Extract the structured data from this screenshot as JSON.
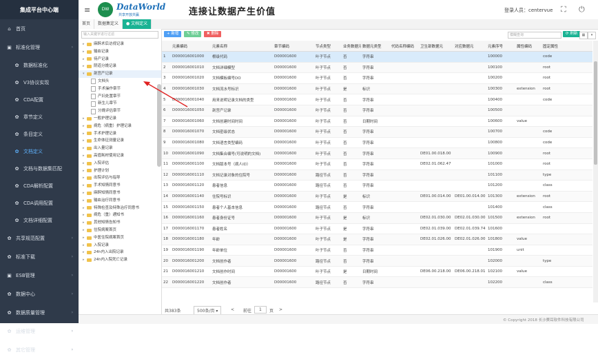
{
  "app": {
    "title": "集成平台中心端"
  },
  "sidebar": {
    "items": [
      {
        "label": "首页",
        "icon": "home-icon",
        "glyph": "⌂",
        "sub": false
      },
      {
        "label": "标准化管理",
        "icon": "folder-icon",
        "glyph": "▣",
        "sub": false
      },
      {
        "label": "数据标准化",
        "icon": "gear-icon",
        "glyph": "✿",
        "sub": true
      },
      {
        "label": "V3协议实现",
        "icon": "gear-icon",
        "glyph": "✿",
        "sub": true
      },
      {
        "label": "CDA配置",
        "icon": "gear-icon",
        "glyph": "✿",
        "sub": true
      },
      {
        "label": "章节定义",
        "icon": "gear-icon",
        "glyph": "✿",
        "sub": true
      },
      {
        "label": "条目定义",
        "icon": "gear-icon",
        "glyph": "✿",
        "sub": true
      },
      {
        "label": "文档定义",
        "icon": "gear-icon",
        "glyph": "✿",
        "sub": true,
        "active": true
      },
      {
        "label": "文档与数据集匹配",
        "icon": "gear-icon",
        "glyph": "✿",
        "sub": true
      },
      {
        "label": "CDA解析配置",
        "icon": "gear-icon",
        "glyph": "✿",
        "sub": true
      },
      {
        "label": "CDA调用配置",
        "icon": "gear-icon",
        "glyph": "✿",
        "sub": true
      },
      {
        "label": "文档详细配置",
        "icon": "gear-icon",
        "glyph": "✿",
        "sub": true
      },
      {
        "label": "共享规范配置",
        "icon": "gear-icon",
        "glyph": "✿",
        "sub": false
      },
      {
        "label": "标准下载",
        "icon": "gear-icon",
        "glyph": "✿",
        "sub": false
      },
      {
        "label": "ESB管理",
        "icon": "folder-icon",
        "glyph": "▣",
        "sub": false
      },
      {
        "label": "数据中心",
        "icon": "gear-icon",
        "glyph": "✿",
        "sub": false
      },
      {
        "label": "数据质量管理",
        "icon": "gear-icon",
        "glyph": "✿",
        "sub": false
      },
      {
        "label": "运维管理",
        "icon": "gear-icon",
        "glyph": "✿",
        "sub": false
      },
      {
        "label": "其它管理",
        "icon": "gear-icon",
        "glyph": "✿",
        "sub": false
      }
    ]
  },
  "header": {
    "brand": "DataWorld",
    "brand_sub": "共享开放共赢",
    "slogan": "连接让数据产生价值",
    "user": "登录人员：centervue"
  },
  "tabs": [
    {
      "label": "首页",
      "active": false
    },
    {
      "label": "数据集定义",
      "active": false
    },
    {
      "label": "● 文档定义",
      "active": true
    }
  ],
  "tree": {
    "search_placeholder": "输入关键字进行过滤",
    "nodes": [
      {
        "label": "麻醉术后访视记录",
        "level": 0,
        "kind": "folder"
      },
      {
        "label": "输血记录",
        "level": 0,
        "kind": "folder"
      },
      {
        "label": "待产记录",
        "level": 0,
        "kind": "folder"
      },
      {
        "label": "阴道分娩记录",
        "level": 0,
        "kind": "folder"
      },
      {
        "label": "剖宫产记录",
        "level": 0,
        "kind": "folder",
        "open": true
      },
      {
        "label": "文档头",
        "level": 1,
        "kind": "file"
      },
      {
        "label": "手术操作章节",
        "level": 1,
        "kind": "file"
      },
      {
        "label": "产妇处置章节",
        "level": 1,
        "kind": "file"
      },
      {
        "label": "新生儿章节",
        "level": 1,
        "kind": "file"
      },
      {
        "label": "分娩评估章节",
        "level": 1,
        "kind": "file"
      },
      {
        "label": "一般护理记录",
        "level": 0,
        "kind": "folder"
      },
      {
        "label": "病危（病重）护理记录",
        "level": 0,
        "kind": "folder"
      },
      {
        "label": "手术护理记录",
        "level": 0,
        "kind": "folder"
      },
      {
        "label": "生命体征测量记录",
        "level": 0,
        "kind": "folder"
      },
      {
        "label": "出入量记录",
        "level": 0,
        "kind": "folder"
      },
      {
        "label": "高值耗材使用记录",
        "level": 0,
        "kind": "folder"
      },
      {
        "label": "入院评估",
        "level": 0,
        "kind": "folder"
      },
      {
        "label": "护理计划",
        "level": 0,
        "kind": "folder"
      },
      {
        "label": "出院评估与指导",
        "level": 0,
        "kind": "folder"
      },
      {
        "label": "手术知情同意书",
        "level": 0,
        "kind": "folder"
      },
      {
        "label": "麻醉知情同意书",
        "level": 0,
        "kind": "folder"
      },
      {
        "label": "输血治疗同意书",
        "level": 0,
        "kind": "folder"
      },
      {
        "label": "特殊检查及特殊治疗同意书",
        "level": 0,
        "kind": "folder"
      },
      {
        "label": "病危（重）通知书",
        "level": 0,
        "kind": "folder"
      },
      {
        "label": "其他知情告知书",
        "level": 0,
        "kind": "folder"
      },
      {
        "label": "住院病案首页",
        "level": 0,
        "kind": "folder"
      },
      {
        "label": "中医住院病案首页",
        "level": 0,
        "kind": "folder"
      },
      {
        "label": "入院记录",
        "level": 0,
        "kind": "folder"
      },
      {
        "label": "24h内入出院记录",
        "level": 0,
        "kind": "folder"
      },
      {
        "label": "24h内入院死亡记录",
        "level": 0,
        "kind": "folder"
      }
    ]
  },
  "toolbar": {
    "add": "+ 新增",
    "edit": "✎ 修改",
    "delete": "✖ 删除",
    "search_placeholder": "模糊查询",
    "refresh": "⟳ 刷新",
    "table_icon": "▦",
    "dropdown_icon": "▾"
  },
  "table": {
    "columns": [
      "",
      "元素编码",
      "元素名称",
      "章节编码",
      "节点类型",
      "业务数据元",
      "数据元类型",
      "代码名称编码",
      "卫生部数据元",
      "对应数据元",
      "元素序号",
      "属性编码",
      "固定属性"
    ],
    "rows": [
      [
        "1",
        "D000016001000",
        "根级代码",
        "D00001600",
        "叶子节点",
        "否",
        "字符串",
        "",
        "",
        "",
        "100000",
        "",
        "code"
      ],
      [
        "2",
        "D000016001010",
        "文档详细模型",
        "D00001600",
        "叶子节点",
        "否",
        "字符串",
        "",
        "",
        "",
        "100100",
        "",
        "root"
      ],
      [
        "3",
        "D000016001020",
        "文档模板编号DO",
        "D00001600",
        "叶子节点",
        "否",
        "字符串",
        "",
        "",
        "",
        "100200",
        "",
        "root"
      ],
      [
        "4",
        "D000016001030",
        "文档流水号标识",
        "D00001600",
        "叶子节点",
        "是",
        "标识",
        "",
        "",
        "",
        "100300",
        "extension",
        "root"
      ],
      [
        "5",
        "D000016001040",
        "用来说明记录文档的类型",
        "D00001600",
        "叶子节点",
        "否",
        "字符串",
        "",
        "",
        "",
        "100400",
        "",
        "code"
      ],
      [
        "6",
        "D000016001050",
        "剖宫产记录",
        "D00001600",
        "叶子节点",
        "否",
        "字符串",
        "",
        "",
        "",
        "100500",
        "",
        ""
      ],
      [
        "7",
        "D000016001060",
        "文档创建时间时间",
        "D00001600",
        "叶子节点",
        "否",
        "日期时间",
        "",
        "",
        "",
        "100600",
        "value",
        ""
      ],
      [
        "8",
        "D000016001070",
        "文档密级状态",
        "D00001600",
        "叶子节点",
        "否",
        "字符串",
        "",
        "",
        "",
        "100700",
        "",
        "code"
      ],
      [
        "9",
        "D000016001080",
        "文档语言类型编码",
        "D00001600",
        "叶子节点",
        "否",
        "字符串",
        "",
        "",
        "",
        "100800",
        "",
        "code"
      ],
      [
        "10",
        "D000016001090",
        "文档集合编号(可说明的文档)",
        "D00001600",
        "叶子节点",
        "否",
        "字符串",
        "",
        "DE01.00.018.00",
        "",
        "100900",
        "",
        "root"
      ],
      [
        "11",
        "D000016001100",
        "文档版本号（病人ID）",
        "D00001600",
        "叶子节点",
        "否",
        "字符串",
        "",
        "DE02.01.062.47",
        "",
        "101000",
        "",
        "root"
      ],
      [
        "12",
        "D000016001110",
        "文档记录对象的住院号",
        "D00001600",
        "路径节点",
        "否",
        "字符串",
        "",
        "",
        "",
        "101100",
        "",
        "type"
      ],
      [
        "13",
        "D000016001120",
        "患者信息",
        "D00001600",
        "路径节点",
        "否",
        "字符串",
        "",
        "",
        "",
        "101200",
        "",
        "class"
      ],
      [
        "14",
        "D000016001140",
        "住院号标识",
        "D00001600",
        "叶子节点",
        "是",
        "标识",
        "",
        "DE01.00.014.00",
        "DE01.00.014.00",
        "101300",
        "extension",
        "root"
      ],
      [
        "15",
        "D000016001150",
        "患者个人基本信息",
        "D00001600",
        "路径节点",
        "否",
        "字符串",
        "",
        "",
        "",
        "101400",
        "",
        "class"
      ],
      [
        "16",
        "D000016001160",
        "患者身份证号",
        "D00001600",
        "叶子节点",
        "是",
        "标识",
        "",
        "DE02.01.030.00",
        "DE02.01.030.00",
        "101500",
        "extension",
        "root"
      ],
      [
        "17",
        "D000016001170",
        "患者姓名",
        "D00001600",
        "叶子节点",
        "是",
        "字符串",
        "",
        "DE02.01.039.00",
        "DE02.01.039.74",
        "101600",
        "",
        ""
      ],
      [
        "18",
        "D000016001180",
        "年龄",
        "D00001600",
        "叶子节点",
        "是",
        "字符串",
        "",
        "DE02.01.026.00",
        "DE02.01.026.00",
        "101800",
        "value",
        ""
      ],
      [
        "19",
        "D000016001190",
        "年龄单位",
        "D00001600",
        "叶子节点",
        "否",
        "字符串",
        "",
        "",
        "",
        "101900",
        "unit",
        ""
      ],
      [
        "20",
        "D000016001200",
        "文档创作者",
        "D00001600",
        "路径节点",
        "否",
        "字符串",
        "",
        "",
        "",
        "102000",
        "",
        "type"
      ],
      [
        "21",
        "D000016001210",
        "文档创作时间",
        "D00001600",
        "叶子节点",
        "是",
        "日期时间",
        "",
        "DE06.00.218.00",
        "DE06.00.218.01",
        "102100",
        "value",
        ""
      ],
      [
        "22",
        "D000016001220",
        "文档创作者",
        "D00001600",
        "路径节点",
        "否",
        "字符串",
        "",
        "",
        "",
        "102200",
        "",
        "class"
      ]
    ]
  },
  "pager": {
    "total": "共383条",
    "page_size": "500条/页",
    "prev": "<",
    "goto_label": "前往",
    "page": "1",
    "page_suffix": "页",
    "next": ">"
  },
  "footer": {
    "copyright": "© Copyright 2018 长沙赛耳软件科技有限公司"
  },
  "colors": {
    "sidebar_bg": "#2f3a4a",
    "accent": "#1ab394",
    "add_btn": "#4f9ff5",
    "edit_btn": "#6fcf97",
    "delete_btn": "#f06060"
  }
}
